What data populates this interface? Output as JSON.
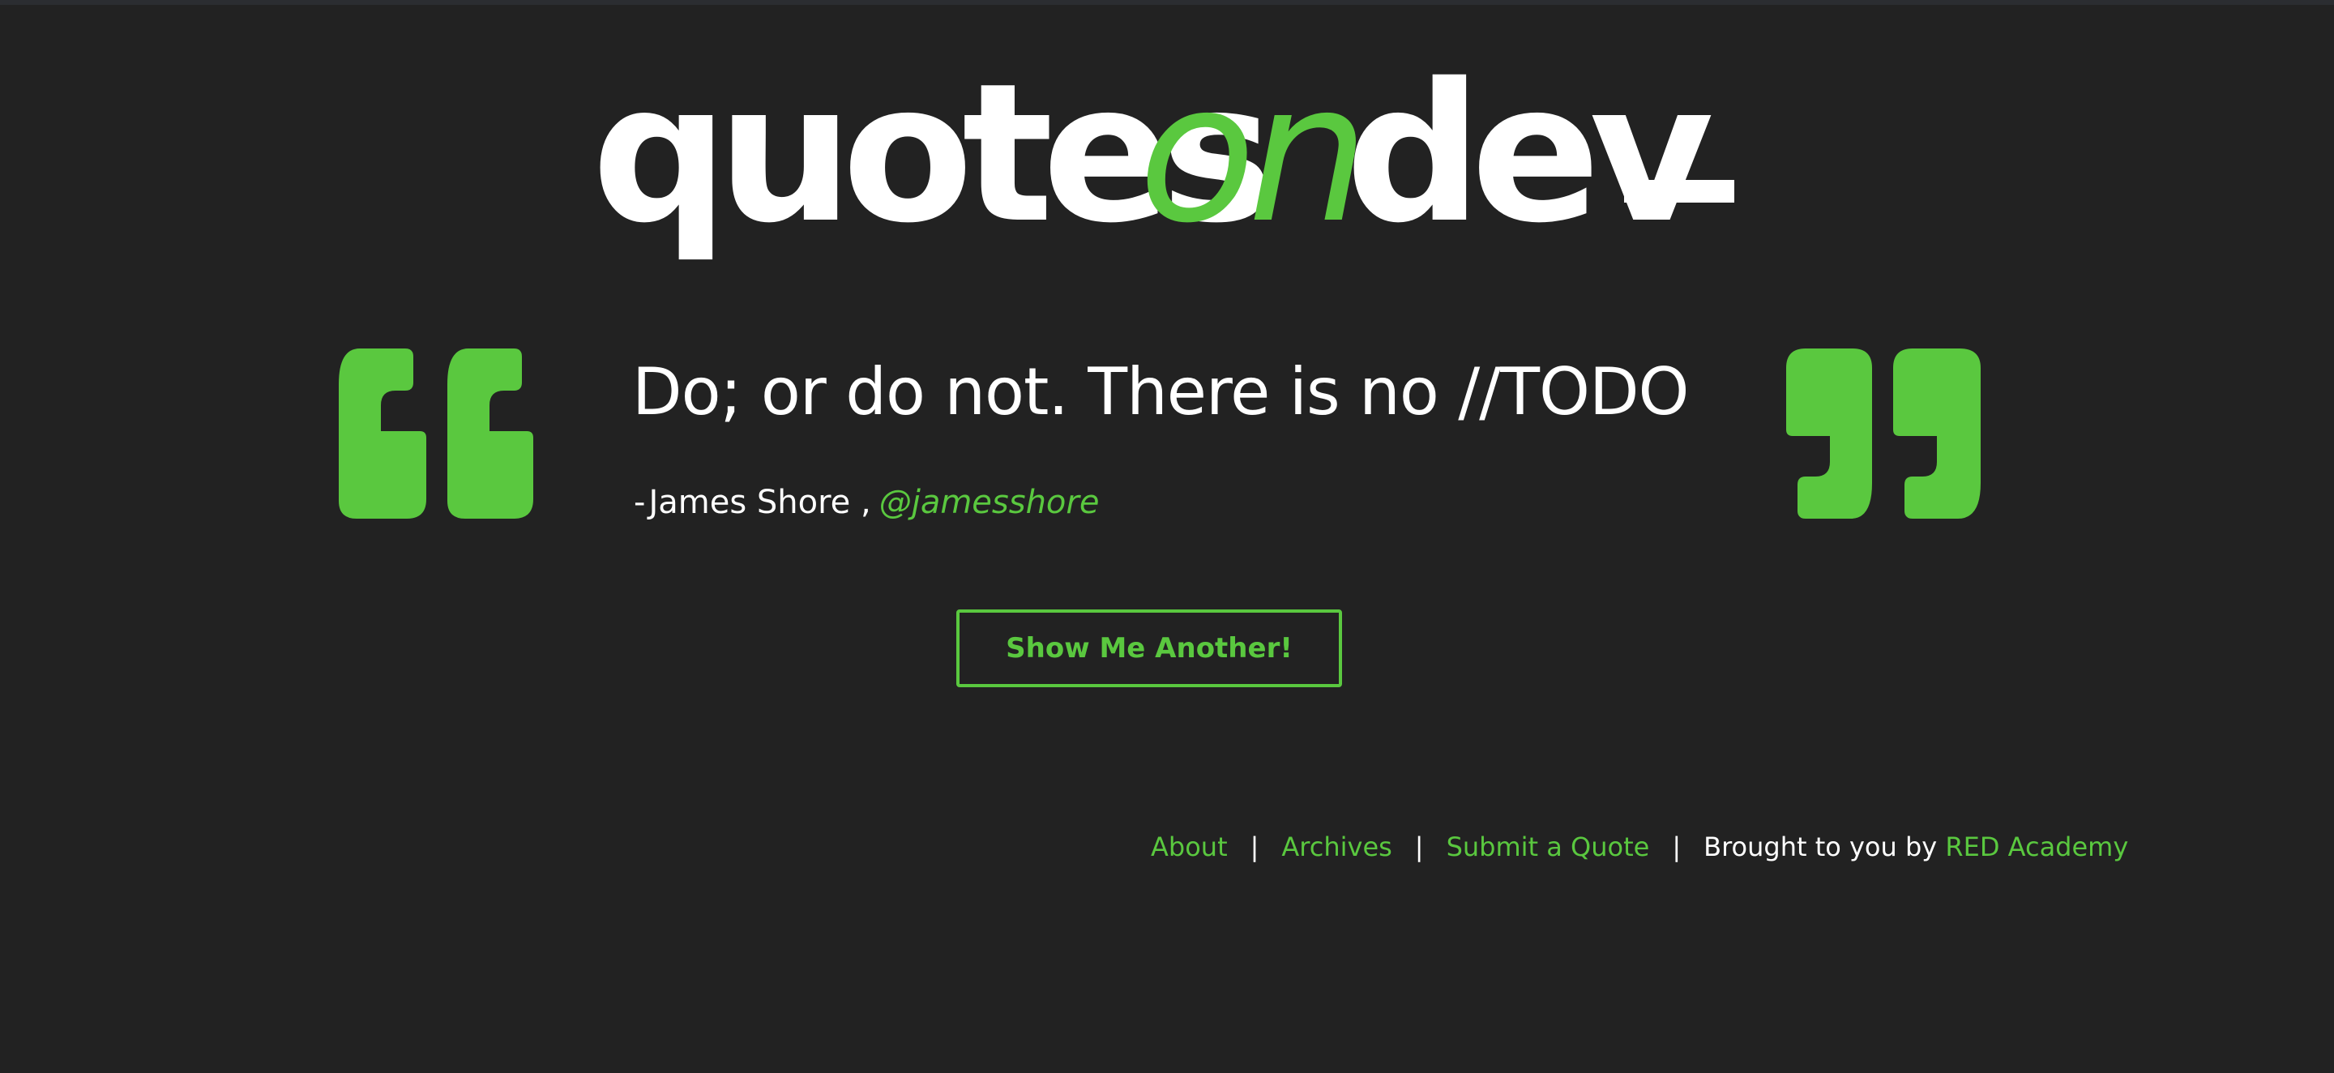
{
  "header": {
    "logo_quotes": "quotes",
    "logo_on": "on",
    "logo_dev": "dev"
  },
  "quote": {
    "text": "Do; or do not. There is no //TODO",
    "dash": "-",
    "author": "James Shore ,",
    "source": "@jamesshore"
  },
  "actions": {
    "show_another_label": "Show Me Another!"
  },
  "footer": {
    "about": "About",
    "archives": "Archives",
    "submit": "Submit a Quote",
    "separator": "|",
    "brought_by": "Brought to you by",
    "academy": "RED Academy"
  },
  "icons": {
    "open_quote": "open-quote-icon",
    "close_quote": "close-quote-icon"
  },
  "colors": {
    "background": "#222222",
    "accent": "#5ac83f",
    "text": "#ffffff"
  }
}
